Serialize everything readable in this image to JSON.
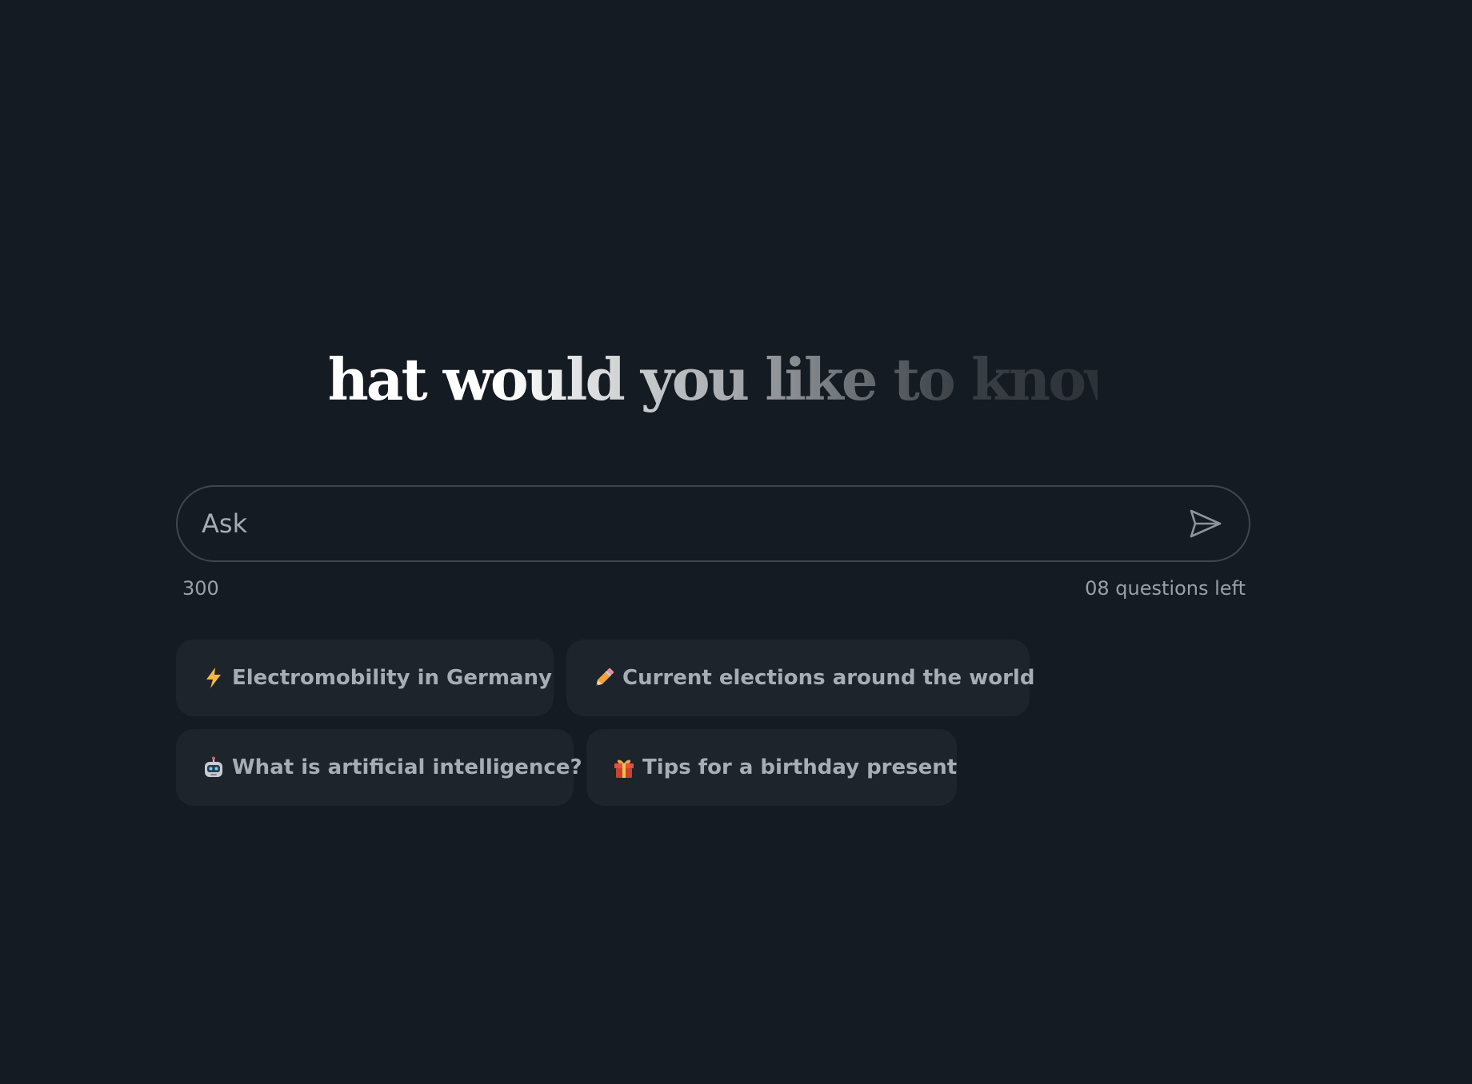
{
  "headline": "What would you like to know?",
  "ask": {
    "placeholder": "Ask",
    "char_counter": "300",
    "questions_left": "08 questions left",
    "send_icon": "send-icon"
  },
  "suggestions": [
    {
      "icon": "lightning-icon",
      "label": "Electromobility in Germany"
    },
    {
      "icon": "pencil-icon",
      "label": "Current elections around the world"
    },
    {
      "icon": "robot-icon",
      "label": "What is artificial intelligence?"
    },
    {
      "icon": "gift-icon",
      "label": "Tips for a birthday present"
    }
  ],
  "colors": {
    "background": "#151b22",
    "chip_background": "#1e242c",
    "input_border": "#3f464e",
    "muted_text": "#9aa0a6",
    "lightning": "#f5b83d",
    "gift": "#e0533d"
  }
}
